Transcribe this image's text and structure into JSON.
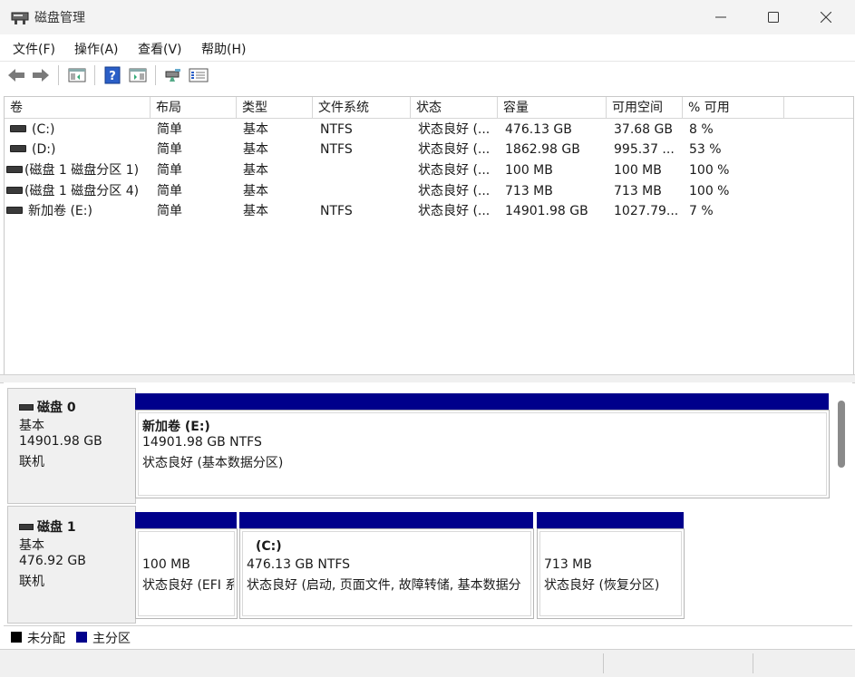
{
  "window": {
    "title": "磁盘管理"
  },
  "menu": [
    "文件(F)",
    "操作(A)",
    "查看(V)",
    "帮助(H)"
  ],
  "toolbar": {
    "icons": [
      "back-arrow-icon",
      "forward-arrow-icon",
      "console-tree-icon",
      "help-icon",
      "console-pane-icon",
      "connect-icon",
      "properties-icon"
    ]
  },
  "columns": [
    "卷",
    "布局",
    "类型",
    "文件系统",
    "状态",
    "容量",
    "可用空间",
    "% 可用"
  ],
  "volumes": [
    [
      "(C:)",
      "简单",
      "基本",
      "NTFS",
      "状态良好 (...",
      "476.13 GB",
      "37.68 GB",
      "8 %"
    ],
    [
      "(D:)",
      "简单",
      "基本",
      "NTFS",
      "状态良好 (...",
      "1862.98 GB",
      "995.37 ...",
      "53 %"
    ],
    [
      "(磁盘 1 磁盘分区 1)",
      "简单",
      "基本",
      "",
      "状态良好 (...",
      "100 MB",
      "100 MB",
      "100 %"
    ],
    [
      "(磁盘 1 磁盘分区 4)",
      "简单",
      "基本",
      "",
      "状态良好 (...",
      "713 MB",
      "713 MB",
      "100 %"
    ],
    [
      "新加卷 (E:)",
      "简单",
      "基本",
      "NTFS",
      "状态良好 (...",
      "14901.98 GB",
      "1027.79...",
      "7 %"
    ]
  ],
  "disks": [
    {
      "name": "磁盘 0",
      "type": "基本",
      "size": "14901.98 GB",
      "state": "联机",
      "partitions": [
        {
          "title": "新加卷  (E:)",
          "line1": "14901.98 GB NTFS",
          "line2": "状态良好 (基本数据分区)"
        }
      ]
    },
    {
      "name": "磁盘 1",
      "type": "基本",
      "size": "476.92 GB",
      "state": "联机",
      "partitions": [
        {
          "title": "",
          "line1": "100 MB",
          "line2": "状态良好 (EFI 系"
        },
        {
          "title": "(C:)",
          "line1": "476.13 GB NTFS",
          "line2": "状态良好 (启动, 页面文件, 故障转储, 基本数据分"
        },
        {
          "title": "",
          "line1": "713 MB",
          "line2": "状态良好 (恢复分区)"
        }
      ]
    }
  ],
  "legend": [
    {
      "label": "未分配",
      "color": "#000000"
    },
    {
      "label": "主分区",
      "color": "#00008b"
    }
  ],
  "colors": {
    "primary_partition": "#00008b",
    "unallocated": "#000000"
  }
}
